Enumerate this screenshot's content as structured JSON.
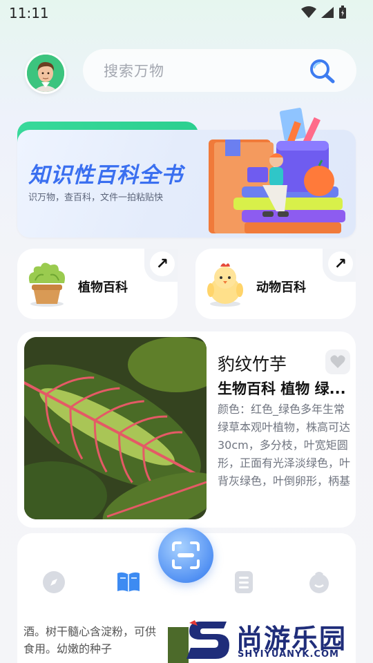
{
  "status_bar": {
    "time": "11:11"
  },
  "search": {
    "placeholder": "搜索万物"
  },
  "banner": {
    "title": "知识性百科全书",
    "subtitle": "识万物，查百科，文件一拍粘贴快"
  },
  "categories": [
    {
      "label": "植物百科",
      "arrow": "↗"
    },
    {
      "label": "动物百科",
      "arrow": "↗"
    }
  ],
  "feature": {
    "title": "豹纹竹芋",
    "tags": "生物百科 植物 绿...",
    "description": "颜色：红色_绿色多年生常绿草本观叶植物，株高可达30cm，多分枝，叶宽矩圆形，正面有光泽淡绿色，叶背灰绿色，叶倒卵形，柄基"
  },
  "bottom": {
    "text": "酒。树干髓心含淀粉，可供食用。幼嫩的种子"
  },
  "watermark": {
    "logo_text": "尚游乐园",
    "url": "SHYIYUANYK.COM"
  },
  "colors": {
    "accent": "#3a6ff0",
    "green_tab": "#2bcf8f",
    "scan": "#4d8df2"
  }
}
